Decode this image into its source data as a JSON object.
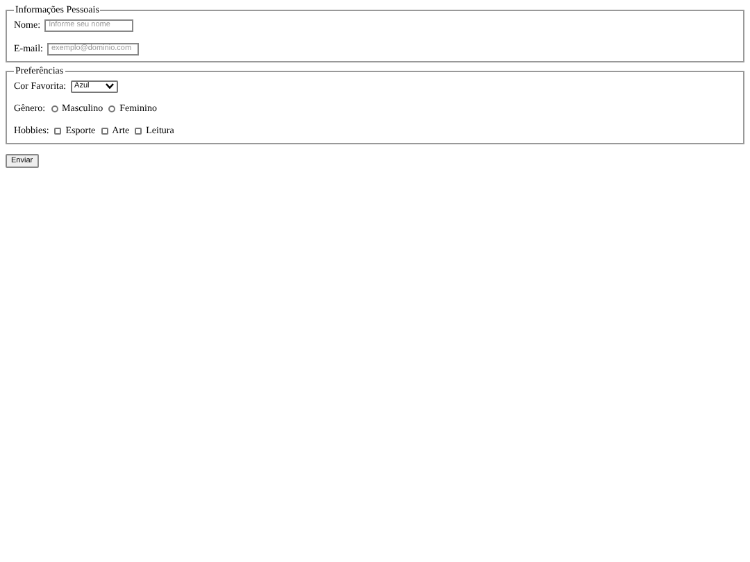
{
  "personal": {
    "legend": "Informações Pessoais",
    "name_label": "Nome:",
    "name_placeholder": "Informe seu nome",
    "email_label": "E-mail:",
    "email_placeholder": "exemplo@dominio.com"
  },
  "preferences": {
    "legend": "Preferências",
    "color_label": "Cor Favorita:",
    "color_value": "Azul",
    "gender_label": "Gênero:",
    "genders": [
      {
        "label": "Masculino",
        "selected": false
      },
      {
        "label": "Feminino",
        "selected": false
      }
    ],
    "hobbies_label": "Hobbies:",
    "hobbies": [
      {
        "label": "Esporte",
        "checked": false
      },
      {
        "label": "Arte",
        "checked": false
      },
      {
        "label": "Leitura",
        "checked": false
      }
    ]
  },
  "submit": "Enviar"
}
